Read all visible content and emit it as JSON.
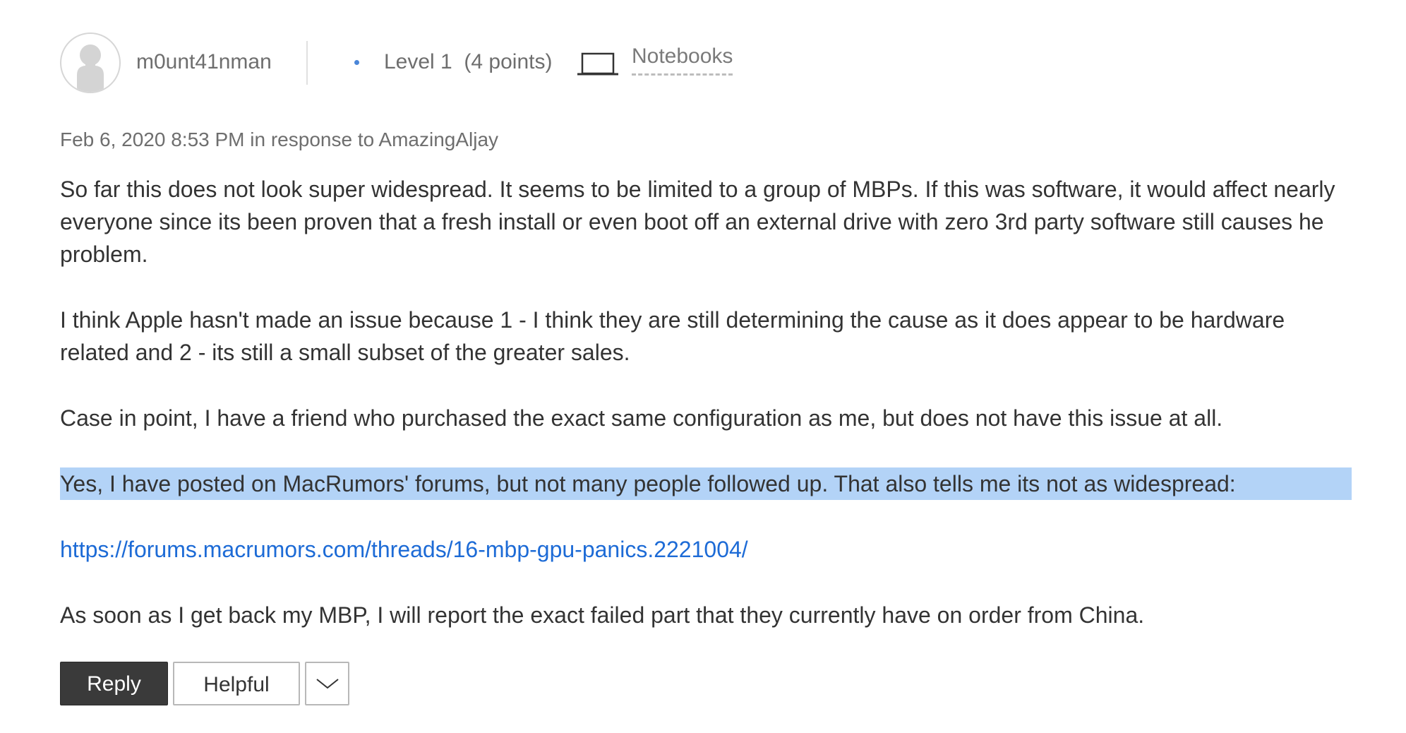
{
  "author": {
    "username": "m0unt41nman",
    "level_text": "Level 1  (4 points)",
    "community_icon": "laptop-icon",
    "community": "Notebooks",
    "avatar_icon": "default-user-silhouette-icon"
  },
  "meta": {
    "timestamp_line": "Feb 6, 2020 8:53 PM in response to AmazingAljay"
  },
  "body": {
    "p1": "So far this does not look super widespread.  It seems to be limited to a group of MBPs.  If this was software, it would affect nearly everyone since its been proven that a fresh install or even boot off an external drive with zero 3rd party software still causes he problem.",
    "p2": "I think Apple hasn't made an issue because 1 - I think they are still determining the cause as it does appear to be hardware related and 2 - its still a small subset of the greater sales.",
    "p3": "Case in point, I have a friend who purchased the exact same configuration as me, but does not have this issue at all.",
    "p4_highlighted": "Yes, I have posted on MacRumors' forums, but not many people followed up.  That also tells me its not as widespread:",
    "link": "https://forums.macrumors.com/threads/16-mbp-gpu-panics.2221004/",
    "p5": "As soon as I get back my MBP, I will report the exact failed part that they currently have on order from China."
  },
  "actions": {
    "reply_label": "Reply",
    "helpful_label": "Helpful",
    "more_icon": "chevron-down-icon"
  },
  "colors": {
    "highlight": "#b3d3f7",
    "link": "#1d6bd6",
    "level_dot": "#4a86d8",
    "reply_button": "#3a3a3a"
  }
}
